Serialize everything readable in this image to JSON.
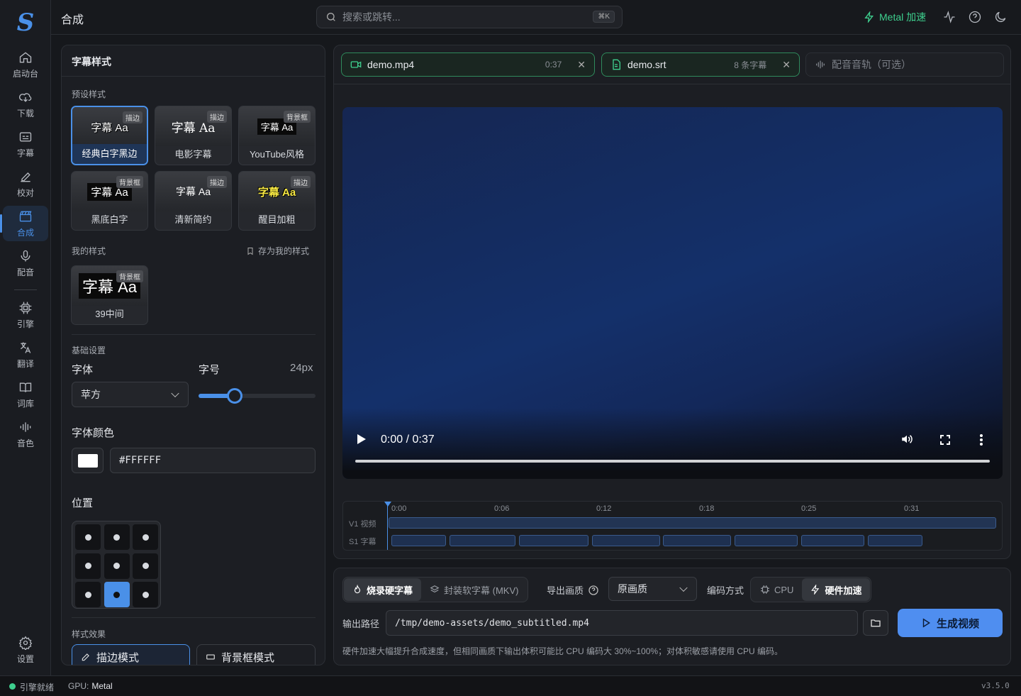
{
  "app": {
    "logo": "S",
    "page_title": "合成"
  },
  "rail": {
    "items": [
      {
        "label": "启动台",
        "icon": "home-icon"
      },
      {
        "label": "下载",
        "icon": "download-cloud-icon"
      },
      {
        "label": "字幕",
        "icon": "subtitles-icon"
      },
      {
        "label": "校对",
        "icon": "pen-icon"
      },
      {
        "label": "合成",
        "icon": "clapperboard-icon",
        "active": true
      },
      {
        "label": "配音",
        "icon": "mic-icon"
      },
      {
        "label": "引擎",
        "icon": "cpu-icon"
      },
      {
        "label": "翻译",
        "icon": "translate-icon"
      },
      {
        "label": "词库",
        "icon": "book-icon"
      },
      {
        "label": "音色",
        "icon": "waveform-icon"
      }
    ],
    "settings": "设置"
  },
  "topbar": {
    "search_placeholder": "搜索或跳转...",
    "shortcut": "⌘K",
    "metal": "Metal 加速"
  },
  "style_panel": {
    "title": "字幕样式",
    "preset_section": "预设样式",
    "presets": [
      {
        "preview": "字幕 Aa",
        "tag": "描边",
        "label": "经典白字黑边",
        "selected": true
      },
      {
        "preview": "字幕 Aa",
        "tag": "描边",
        "label": "电影字幕"
      },
      {
        "preview": "字幕 Aa",
        "tag": "背景框",
        "label": "YouTube风格"
      },
      {
        "preview": "字幕 Aa",
        "tag": "背景框",
        "label": "黑底白字"
      },
      {
        "preview": "字幕 Aa",
        "tag": "描边",
        "label": "清新简约"
      },
      {
        "preview": "字幕 Aa",
        "tag": "描边",
        "label": "醒目加粗"
      }
    ],
    "my_section": "我的样式",
    "save_mine": "存为我的样式",
    "my_styles": [
      {
        "preview": "字幕 Aa",
        "tag": "背景框",
        "label": "39中间"
      }
    ],
    "basic_section": "基础设置",
    "font_label": "字体",
    "font_value": "苹方",
    "size_label": "字号",
    "size_value": "24px",
    "size_fraction": 0.24,
    "color_label": "字体颜色",
    "color_value": "#FFFFFF",
    "position_label": "位置",
    "position_selected": 7,
    "effect_section": "样式效果",
    "effect_modes": [
      "描边模式",
      "背景框模式"
    ]
  },
  "media": {
    "video_file": {
      "name": "demo.mp4",
      "meta": "0:37"
    },
    "srt_file": {
      "name": "demo.srt",
      "meta": "8 条字幕"
    },
    "audio_placeholder": "配音音轨（可选）",
    "player": {
      "time": "0:00 / 0:37",
      "progress": 0
    },
    "timeline": {
      "ticks": [
        "0:00",
        "0:06",
        "0:12",
        "0:18",
        "0:25",
        "0:31"
      ],
      "track_video": "V1 视频",
      "track_sub": "S1 字幕"
    }
  },
  "export": {
    "mode_hard": "烧录硬字幕",
    "mode_soft": "封装软字幕 (MKV)",
    "quality_label": "导出画质",
    "quality_value": "原画质",
    "encode_label": "编码方式",
    "enc_cpu": "CPU",
    "enc_hw": "硬件加速",
    "path_label": "输出路径",
    "path_value": "/tmp/demo-assets/demo_subtitled.mp4",
    "generate": "生成视频",
    "note": "硬件加速大幅提升合成速度，但相同画质下输出体积可能比 CPU 编码大 30%~100%；对体积敏感请使用 CPU 编码。"
  },
  "status": {
    "engine": "引擎就绪",
    "gpu_label": "GPU:",
    "gpu_value": "Metal",
    "version": "v3.5.0"
  },
  "colors": {
    "accent": "#4a90e8",
    "green": "#3ecf8e"
  }
}
